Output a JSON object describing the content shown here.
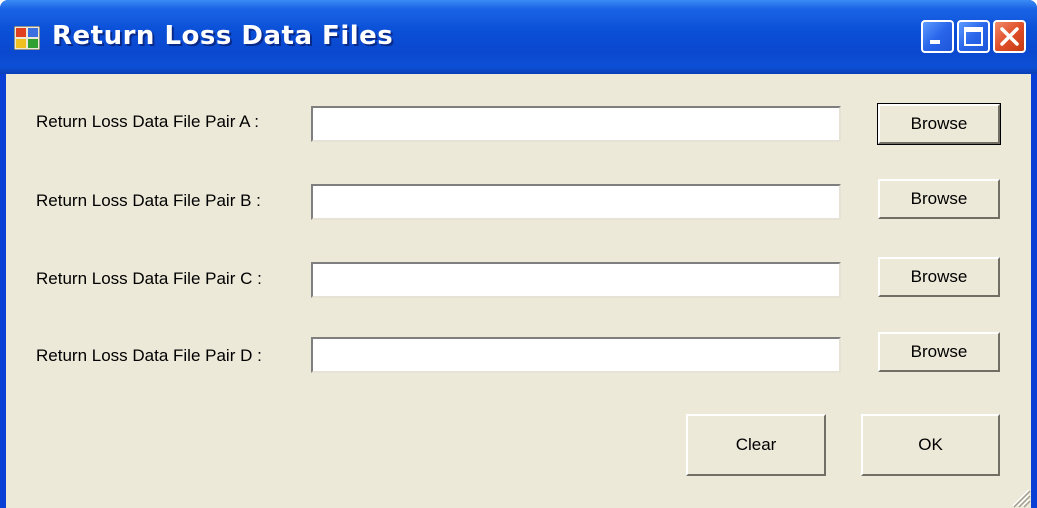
{
  "window": {
    "title": "Return Loss Data Files",
    "controls": {
      "minimize": "minimize-icon",
      "maximize": "maximize-icon",
      "close": "close-icon"
    }
  },
  "rows": [
    {
      "label": "Return Loss Data File Pair A :",
      "value": "",
      "browse_label": "Browse"
    },
    {
      "label": "Return Loss Data File Pair B :",
      "value": "",
      "browse_label": "Browse"
    },
    {
      "label": "Return Loss Data File Pair C :",
      "value": "",
      "browse_label": "Browse"
    },
    {
      "label": "Return Loss Data File Pair D :",
      "value": "",
      "browse_label": "Browse"
    }
  ],
  "actions": {
    "clear_label": "Clear",
    "ok_label": "OK"
  },
  "colors": {
    "titlebar": "#0b50d8",
    "client_background": "#ece9d8",
    "close_button": "#e0502a"
  }
}
